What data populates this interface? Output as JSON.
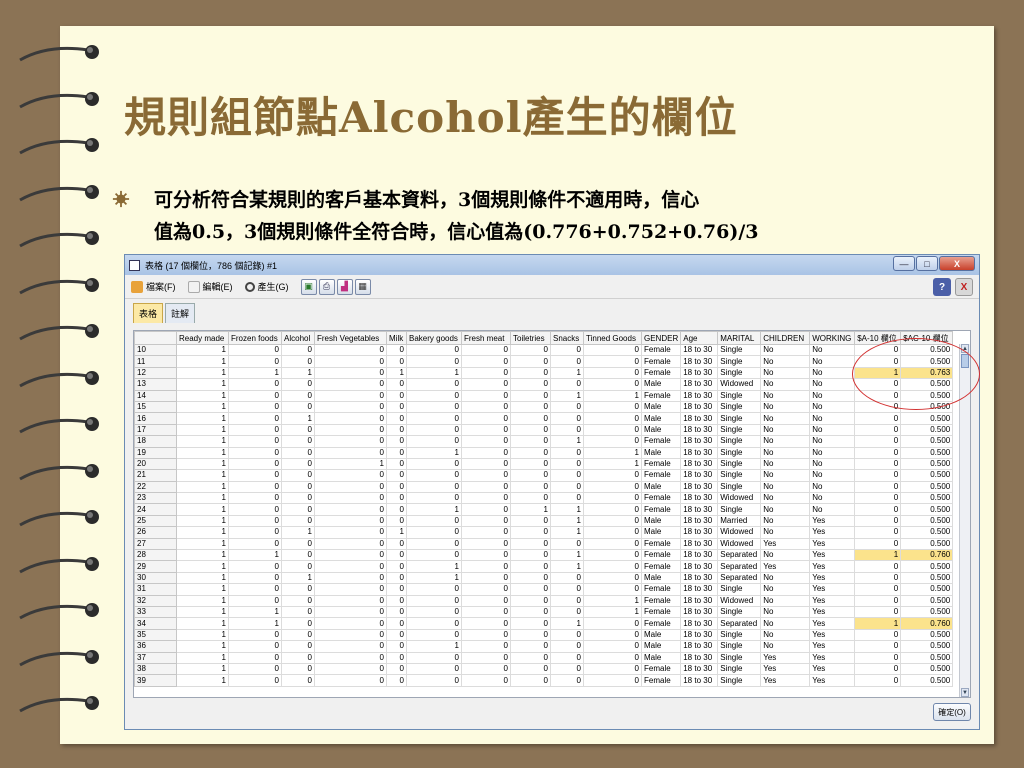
{
  "slide": {
    "title": "規則組節點Alcohol產生的欄位",
    "bullet": "可分析符合某規則的客戶基本資料，3個規則條件不適用時，信心\n值為0.5，3個規則條件全符合時，信心值為(0.776+0.752+0.76)/3"
  },
  "window": {
    "title": "表格 (17 個欄位，786 個記錄) #1",
    "minimize": "—",
    "maximize": "□",
    "close": "X"
  },
  "toolbar": {
    "file": "檔案(F)",
    "edit": "編輯(E)",
    "generate": "產生(G)",
    "help": "?",
    "close": "X"
  },
  "tabs": [
    "表格",
    "註解"
  ],
  "table": {
    "columns": [
      "",
      "Ready made",
      "Frozen foods",
      "Alcohol",
      "Fresh Vegetables",
      "Milk",
      "Bakery goods",
      "Fresh meat",
      "Toiletries",
      "Snacks",
      "Tinned Goods",
      "GENDER",
      "Age",
      "MARITAL",
      "CHILDREN",
      "WORKING",
      "$A-10 欄位",
      "$AC-10 欄位"
    ],
    "rows": [
      [
        "10",
        "1",
        "0",
        "0",
        "0",
        "0",
        "0",
        "0",
        "0",
        "0",
        "0",
        "Female",
        "18 to 30",
        "Single",
        "No",
        "No",
        "0",
        "0.500"
      ],
      [
        "11",
        "1",
        "0",
        "0",
        "0",
        "0",
        "0",
        "0",
        "0",
        "0",
        "0",
        "Female",
        "18 to 30",
        "Single",
        "No",
        "No",
        "0",
        "0.500"
      ],
      [
        "12",
        "1",
        "1",
        "1",
        "0",
        "1",
        "1",
        "0",
        "0",
        "1",
        "0",
        "Female",
        "18 to 30",
        "Single",
        "No",
        "No",
        "1",
        "0.763"
      ],
      [
        "13",
        "1",
        "0",
        "0",
        "0",
        "0",
        "0",
        "0",
        "0",
        "0",
        "0",
        "Male",
        "18 to 30",
        "Widowed",
        "No",
        "No",
        "0",
        "0.500"
      ],
      [
        "14",
        "1",
        "0",
        "0",
        "0",
        "0",
        "0",
        "0",
        "0",
        "1",
        "1",
        "Female",
        "18 to 30",
        "Single",
        "No",
        "No",
        "0",
        "0.500"
      ],
      [
        "15",
        "1",
        "0",
        "0",
        "0",
        "0",
        "0",
        "0",
        "0",
        "0",
        "0",
        "Male",
        "18 to 30",
        "Single",
        "No",
        "No",
        "0",
        "0.500"
      ],
      [
        "16",
        "1",
        "0",
        "1",
        "0",
        "0",
        "0",
        "0",
        "0",
        "0",
        "0",
        "Male",
        "18 to 30",
        "Single",
        "No",
        "No",
        "0",
        "0.500"
      ],
      [
        "17",
        "1",
        "0",
        "0",
        "0",
        "0",
        "0",
        "0",
        "0",
        "0",
        "0",
        "Male",
        "18 to 30",
        "Single",
        "No",
        "No",
        "0",
        "0.500"
      ],
      [
        "18",
        "1",
        "0",
        "0",
        "0",
        "0",
        "0",
        "0",
        "0",
        "1",
        "0",
        "Female",
        "18 to 30",
        "Single",
        "No",
        "No",
        "0",
        "0.500"
      ],
      [
        "19",
        "1",
        "0",
        "0",
        "0",
        "0",
        "1",
        "0",
        "0",
        "0",
        "1",
        "Male",
        "18 to 30",
        "Single",
        "No",
        "No",
        "0",
        "0.500"
      ],
      [
        "20",
        "1",
        "0",
        "0",
        "1",
        "0",
        "0",
        "0",
        "0",
        "0",
        "1",
        "Female",
        "18 to 30",
        "Single",
        "No",
        "No",
        "0",
        "0.500"
      ],
      [
        "21",
        "1",
        "0",
        "0",
        "0",
        "0",
        "0",
        "0",
        "0",
        "0",
        "0",
        "Female",
        "18 to 30",
        "Single",
        "No",
        "No",
        "0",
        "0.500"
      ],
      [
        "22",
        "1",
        "0",
        "0",
        "0",
        "0",
        "0",
        "0",
        "0",
        "0",
        "0",
        "Male",
        "18 to 30",
        "Single",
        "No",
        "No",
        "0",
        "0.500"
      ],
      [
        "23",
        "1",
        "0",
        "0",
        "0",
        "0",
        "0",
        "0",
        "0",
        "0",
        "0",
        "Female",
        "18 to 30",
        "Widowed",
        "No",
        "No",
        "0",
        "0.500"
      ],
      [
        "24",
        "1",
        "0",
        "0",
        "0",
        "0",
        "1",
        "0",
        "1",
        "1",
        "0",
        "Female",
        "18 to 30",
        "Single",
        "No",
        "No",
        "0",
        "0.500"
      ],
      [
        "25",
        "1",
        "0",
        "0",
        "0",
        "0",
        "0",
        "0",
        "0",
        "1",
        "0",
        "Male",
        "18 to 30",
        "Married",
        "No",
        "Yes",
        "0",
        "0.500"
      ],
      [
        "26",
        "1",
        "0",
        "1",
        "0",
        "1",
        "0",
        "0",
        "0",
        "1",
        "0",
        "Male",
        "18 to 30",
        "Widowed",
        "No",
        "Yes",
        "0",
        "0.500"
      ],
      [
        "27",
        "1",
        "0",
        "0",
        "0",
        "0",
        "0",
        "0",
        "0",
        "0",
        "0",
        "Female",
        "18 to 30",
        "Widowed",
        "Yes",
        "Yes",
        "0",
        "0.500"
      ],
      [
        "28",
        "1",
        "1",
        "0",
        "0",
        "0",
        "0",
        "0",
        "0",
        "1",
        "0",
        "Female",
        "18 to 30",
        "Separated",
        "No",
        "Yes",
        "1",
        "0.760"
      ],
      [
        "29",
        "1",
        "0",
        "0",
        "0",
        "0",
        "1",
        "0",
        "0",
        "1",
        "0",
        "Female",
        "18 to 30",
        "Separated",
        "Yes",
        "Yes",
        "0",
        "0.500"
      ],
      [
        "30",
        "1",
        "0",
        "1",
        "0",
        "0",
        "1",
        "0",
        "0",
        "0",
        "0",
        "Male",
        "18 to 30",
        "Separated",
        "No",
        "Yes",
        "0",
        "0.500"
      ],
      [
        "31",
        "1",
        "0",
        "0",
        "0",
        "0",
        "0",
        "0",
        "0",
        "0",
        "0",
        "Female",
        "18 to 30",
        "Single",
        "No",
        "Yes",
        "0",
        "0.500"
      ],
      [
        "32",
        "1",
        "0",
        "0",
        "0",
        "0",
        "0",
        "0",
        "0",
        "0",
        "1",
        "Female",
        "18 to 30",
        "Widowed",
        "No",
        "Yes",
        "0",
        "0.500"
      ],
      [
        "33",
        "1",
        "1",
        "0",
        "0",
        "0",
        "0",
        "0",
        "0",
        "0",
        "1",
        "Female",
        "18 to 30",
        "Single",
        "No",
        "Yes",
        "0",
        "0.500"
      ],
      [
        "34",
        "1",
        "1",
        "0",
        "0",
        "0",
        "0",
        "0",
        "0",
        "1",
        "0",
        "Female",
        "18 to 30",
        "Separated",
        "No",
        "Yes",
        "1",
        "0.760"
      ],
      [
        "35",
        "1",
        "0",
        "0",
        "0",
        "0",
        "0",
        "0",
        "0",
        "0",
        "0",
        "Male",
        "18 to 30",
        "Single",
        "No",
        "Yes",
        "0",
        "0.500"
      ],
      [
        "36",
        "1",
        "0",
        "0",
        "0",
        "0",
        "1",
        "0",
        "0",
        "0",
        "0",
        "Male",
        "18 to 30",
        "Single",
        "No",
        "Yes",
        "0",
        "0.500"
      ],
      [
        "37",
        "1",
        "0",
        "0",
        "0",
        "0",
        "0",
        "0",
        "0",
        "0",
        "0",
        "Male",
        "18 to 30",
        "Single",
        "Yes",
        "Yes",
        "0",
        "0.500"
      ],
      [
        "38",
        "1",
        "0",
        "0",
        "0",
        "0",
        "0",
        "0",
        "0",
        "0",
        "0",
        "Female",
        "18 to 30",
        "Single",
        "Yes",
        "Yes",
        "0",
        "0.500"
      ],
      [
        "39",
        "1",
        "0",
        "0",
        "0",
        "0",
        "0",
        "0",
        "0",
        "0",
        "0",
        "Female",
        "18 to 30",
        "Single",
        "Yes",
        "Yes",
        "0",
        "0.500"
      ]
    ],
    "highlight_rows": [
      "12",
      "28",
      "34"
    ]
  },
  "ok_button": "確定(O)",
  "colors": {
    "title": "#8a6a35",
    "highlight": "#fbe38c",
    "annotation": "#d23030"
  }
}
